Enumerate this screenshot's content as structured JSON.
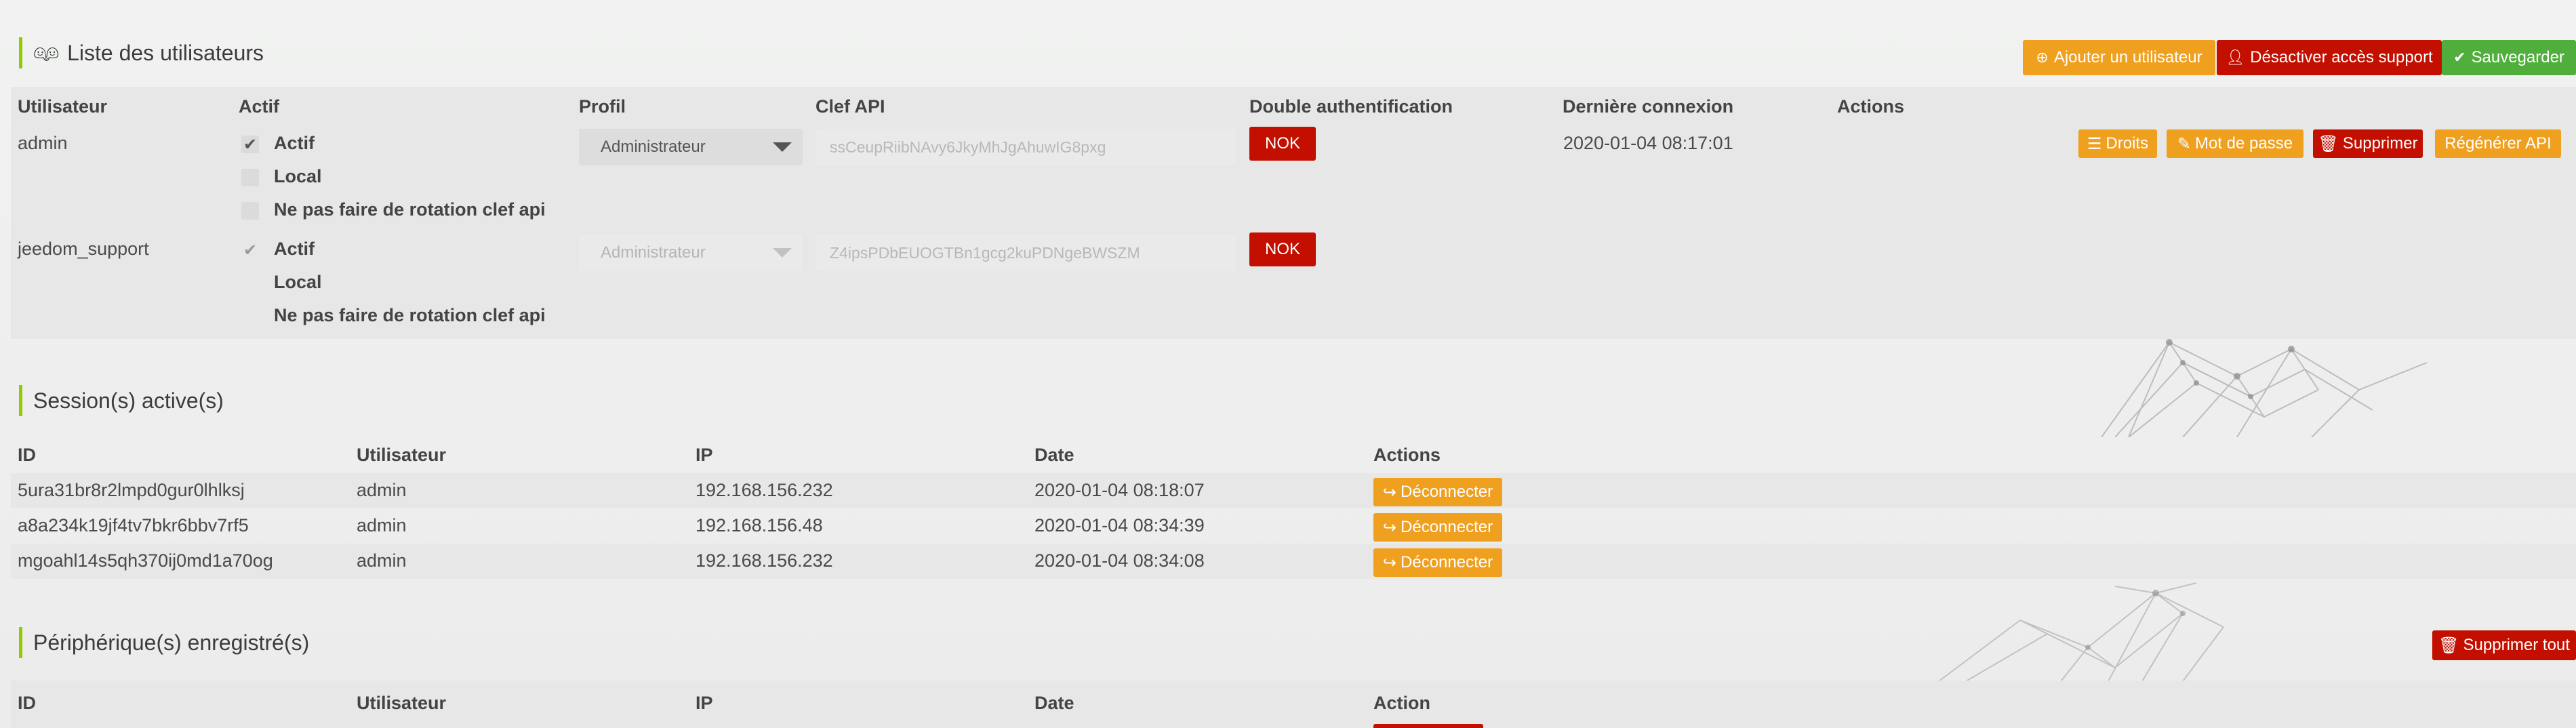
{
  "users_section": {
    "title": "Liste des utilisateurs",
    "icon": "users-icon",
    "buttons": {
      "add_user": "Ajouter un utilisateur",
      "disable_support": "Désactiver accès support",
      "save": "Sauvegarder"
    },
    "headers": {
      "user": "Utilisateur",
      "active": "Actif",
      "profile": "Profil",
      "api_key": "Clef API",
      "two_factor": "Double authentification",
      "last_login": "Dernière connexion",
      "actions": "Actions"
    },
    "checkbox_labels": {
      "active": "Actif",
      "local": "Local",
      "no_rotation": "Ne pas faire de rotation clef api"
    },
    "rows": [
      {
        "username": "admin",
        "active": true,
        "local": false,
        "no_rotation": false,
        "profile": "Administrateur",
        "api_key": "ssCeupRiibNAvy6JkyMhJgAhuwIG8pxg",
        "two_factor": "NOK",
        "last_login": "2020-01-04 08:17:01",
        "actions": {
          "rights": "Droits",
          "password": "Mot de passe",
          "delete": "Supprimer",
          "regenerate_api": "Régénérer API"
        }
      },
      {
        "username": "jeedom_support",
        "active": true,
        "local": false,
        "no_rotation": false,
        "profile": "Administrateur",
        "api_key": "Z4ipsPDbEUOGTBn1gcg2kuPDNgeBWSZM",
        "two_factor": "NOK",
        "last_login": ""
      }
    ]
  },
  "sessions_section": {
    "title": "Session(s) active(s)",
    "headers": {
      "id": "ID",
      "user": "Utilisateur",
      "ip": "IP",
      "date": "Date",
      "actions": "Actions"
    },
    "disconnect_label": "Déconnecter",
    "rows": [
      {
        "id": "5ura31br8r2lmpd0gur0lhlksj",
        "user": "admin",
        "ip": "192.168.156.232",
        "date": "2020-01-04 08:18:07"
      },
      {
        "id": "a8a234k19jf4tv7bkr6bbv7rf5",
        "user": "admin",
        "ip": "192.168.156.48",
        "date": "2020-01-04 08:34:39"
      },
      {
        "id": "mgoahl14s5qh370ij0md1a70og",
        "user": "admin",
        "ip": "192.168.156.232",
        "date": "2020-01-04 08:34:08"
      }
    ]
  },
  "devices_section": {
    "title": "Périphérique(s) enregistré(s)",
    "delete_all": "Supprimer tout",
    "headers": {
      "id": "ID",
      "user": "Utilisateur",
      "ip": "IP",
      "date": "Date",
      "action": "Action"
    }
  },
  "colors": {
    "accent_green": "#94ca02",
    "orange": "#f0a01f",
    "red": "#c20f00",
    "green": "#4fae3c"
  }
}
